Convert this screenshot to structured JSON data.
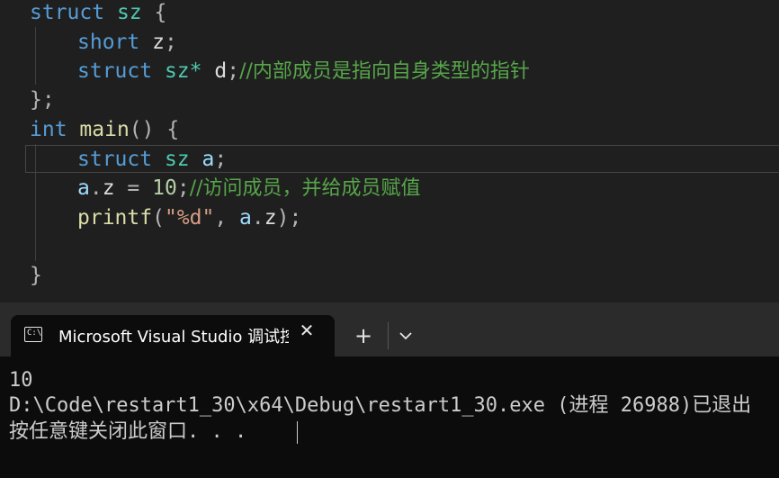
{
  "editor": {
    "lines": [
      {
        "kw": "struct",
        "name": "sz",
        "open": "{"
      },
      {
        "type": "short",
        "var": "z",
        "end": ";"
      },
      {
        "kw": "struct",
        "type": "sz*",
        "var": "d",
        "end": ";",
        "comment": "//内部成员是指向自身类型的指针"
      },
      {
        "close": "};"
      },
      {
        "type": "int",
        "func": "main",
        "parens": "()",
        "open": "{"
      },
      {
        "kw": "struct",
        "type": "sz",
        "var": "a",
        "end": ";"
      },
      {
        "var": "a",
        "dot": ".",
        "member": "z",
        "op": " = ",
        "num": "10",
        "end": ";",
        "comment": "//访问成员，并给成员赋值"
      },
      {
        "func": "printf",
        "lp": "(",
        "str": "\"%d\"",
        "comma": ", ",
        "var": "a",
        "dot": ".",
        "member": "z",
        "rp": ")",
        "end": ";"
      },
      {
        "close": "}"
      }
    ]
  },
  "terminal": {
    "tab_title": "Microsoft Visual Studio 调试控制台",
    "tab_icon_text": "C:\\",
    "close_glyph": "✕",
    "new_tab_glyph": "+",
    "output": [
      "10",
      "D:\\Code\\restart1_30\\x64\\Debug\\restart1_30.exe (进程 26988)已退出",
      "按任意键关闭此窗口. . ."
    ]
  }
}
